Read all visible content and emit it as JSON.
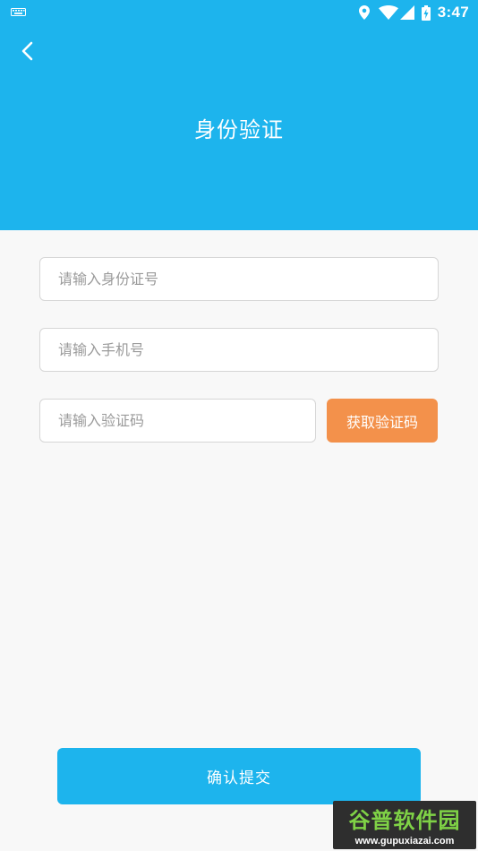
{
  "status_bar": {
    "time": "3:47"
  },
  "header": {
    "title": "身份验证"
  },
  "form": {
    "id_placeholder": "请输入身份证号",
    "phone_placeholder": "请输入手机号",
    "code_placeholder": "请输入验证码",
    "get_code_label": "获取验证码"
  },
  "submit_label": "确认提交",
  "watermark": {
    "name": "谷普软件园",
    "url": "www.gupuxiazai.com"
  },
  "colors": {
    "primary": "#1db4ed",
    "accent": "#f3914b",
    "background": "#f8f8f8"
  },
  "icons": [
    "keyboard-icon",
    "location-icon",
    "wifi-icon",
    "signal-icon",
    "battery-icon",
    "back-arrow-icon"
  ]
}
